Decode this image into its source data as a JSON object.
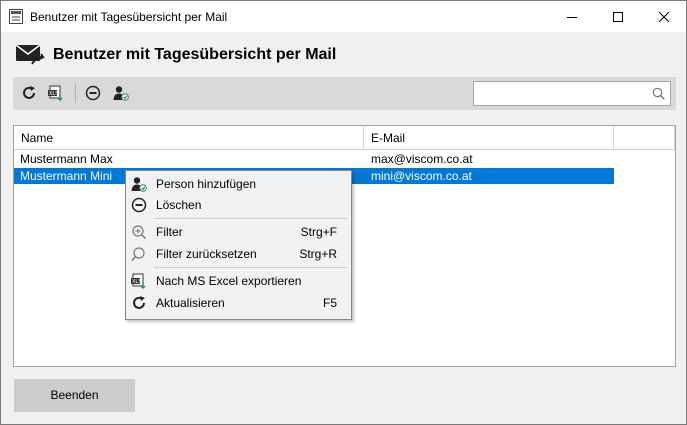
{
  "window": {
    "title": "Benutzer mit Tagesübersicht per Mail"
  },
  "header": {
    "title": "Benutzer mit Tagesübersicht per Mail"
  },
  "toolbar": {
    "buttons": [
      "refresh-icon",
      "excel-export-icon",
      "remove-icon",
      "add-person-icon"
    ],
    "search": {
      "value": "",
      "placeholder": ""
    }
  },
  "table": {
    "columns": [
      "Name",
      "E-Mail"
    ],
    "rows": [
      {
        "name": "Mustermann Max",
        "email": "max@viscom.co.at",
        "selected": false
      },
      {
        "name": "Mustermann Mini",
        "email": "mini@viscom.co.at",
        "selected": true
      }
    ]
  },
  "context_menu": {
    "items": [
      {
        "icon": "add-person-icon",
        "label": "Person hinzufügen",
        "shortcut": ""
      },
      {
        "icon": "remove-icon",
        "label": "Löschen",
        "shortcut": ""
      },
      {
        "icon": "filter-icon",
        "label": "Filter",
        "shortcut": "Strg+F"
      },
      {
        "icon": "search-icon",
        "label": "Filter zurücksetzen",
        "shortcut": "Strg+R"
      },
      {
        "icon": "excel-export-icon",
        "label": "Nach MS Excel exportieren",
        "shortcut": ""
      },
      {
        "icon": "refresh-icon",
        "label": "Aktualisieren",
        "shortcut": "F5"
      }
    ]
  },
  "footer": {
    "close_label": "Beenden"
  },
  "colors": {
    "selection": "#0078d7",
    "toolbar_bg": "#d9d9d9",
    "window_bg": "#f0f0f0"
  }
}
